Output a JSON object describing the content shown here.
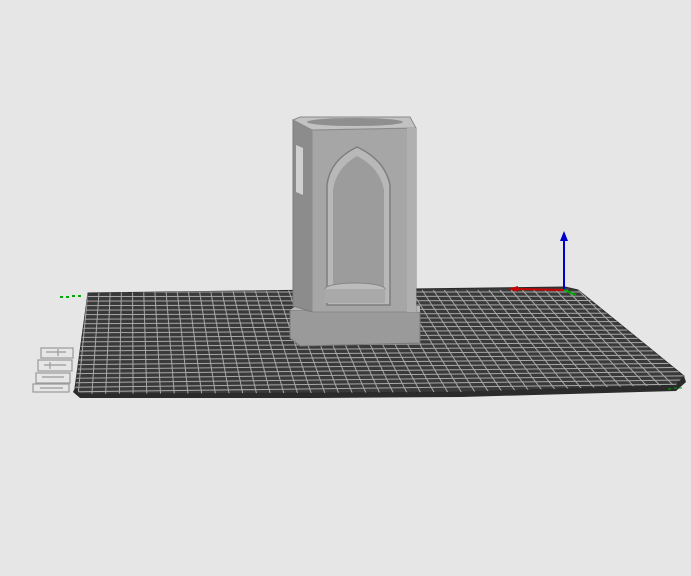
{
  "viewport": {
    "background": "#e6e6e6",
    "bed_color": "#3a3a3a",
    "grid_color": "#a8a8a8",
    "model_color": "#a0a0a0",
    "axis_x_color": "#cc0000",
    "axis_y_color": "#00aa00",
    "axis_z_color": "#0000cc"
  },
  "model": {
    "name": "gothic-lantern-model",
    "icon": "lantern-3d-model"
  },
  "bed": {
    "label_icon": "bed-logo-marks"
  },
  "axes": {
    "x_icon": "x-axis-arrow",
    "y_icon": "y-axis-arrow",
    "z_icon": "z-axis-arrow"
  }
}
